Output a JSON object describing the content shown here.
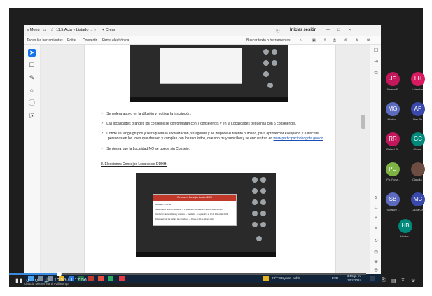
{
  "window": {
    "menu_label": "Menú",
    "tab_title": "11.5.Acta y Listado ...",
    "tab_close": "×",
    "new_tab": "+ Crear",
    "signin": "Iniciar sesión",
    "minimize": "—",
    "maximize": "□",
    "close": "×"
  },
  "toolbar": {
    "all_tools": "Todas las herramientas",
    "edit": "Editar",
    "convert": "Convertir",
    "sign": "Firma electrónica",
    "search": "Buscar texto o herramientas"
  },
  "document": {
    "bullets": [
      "Se redera apoyo en la difusión y motivar la inscripción.",
      "Las localidades grandes los consejos se conformarán con 7 consejer@s y en la Localidades pequeñas con 5 consejer@s.",
      "Donde se tenga grupos y se requiera la socialización, se agenda y se dispone el talento humano, para aprovechar el espacio y e inscribir",
      "personas en los roles que deseen y cumplan con los requisitos, que son muy sencillos y se encuentran en",
      "Se desea que la Localidad NO se quede sin Consejo."
    ],
    "link": "www.participacionbogota.gov.co",
    "section": "II. Elecciones Consejos Locales de DDHH:",
    "table_header": "Elecciones Consejos Locales 2023",
    "table_rows": [
      [
        "Actividad",
        "Fecha"
      ],
      [
        "Socialización de la convocatoria",
        "1 de septiembre de 2023 hasta el 10 de febrero"
      ],
      [
        "Inscripción de candidatos y votantes",
        "Desde 16 - 1 septiembre el 10 de febrero de 2024"
      ],
      [
        "Divulgación de los perfiles de candidatos",
        "Desde el 15 de febrero 2024"
      ]
    ],
    "page_number": "5",
    "page_total": "11"
  },
  "taskbar": {
    "weather": "23°C Mayorm. nubla...",
    "language": "ESP",
    "time": "3:55 p. m.",
    "date": "1/02/2024"
  },
  "player": {
    "time": "10:55 / 1:17:56",
    "caption": "Claudia Milena Martín Villanmga",
    "progress": 0.14
  },
  "participants": [
    {
      "initials": "JE",
      "name": "Jimena E...",
      "color": "#c2185b"
    },
    {
      "initials": "LH",
      "name": "Luisa He...",
      "color": "#d81b60"
    },
    {
      "initials": "MG",
      "name": "Martha ...",
      "color": "#5c6bc0"
    },
    {
      "initials": "AP",
      "name": "Alex Be...",
      "color": "#3949ab"
    },
    {
      "initials": "RR",
      "name": "Rafael St...",
      "color": "#c2185b"
    },
    {
      "initials": "GC",
      "name": "Gloria ...",
      "color": "#00897b"
    },
    {
      "initials": "PG",
      "name": "Pa. Rosa...",
      "color": "#7cb342"
    },
    {
      "initials": "",
      "name": "Claudia ...",
      "color": "#6d4c41"
    },
    {
      "initials": "SB",
      "name": "Solanye ...",
      "color": "#5c6bc0"
    },
    {
      "initials": "MC",
      "name": "Laura Ca...",
      "color": "#3949ab"
    },
    {
      "initials": "HB",
      "name": "Hector ...",
      "color": "#00897b"
    }
  ]
}
